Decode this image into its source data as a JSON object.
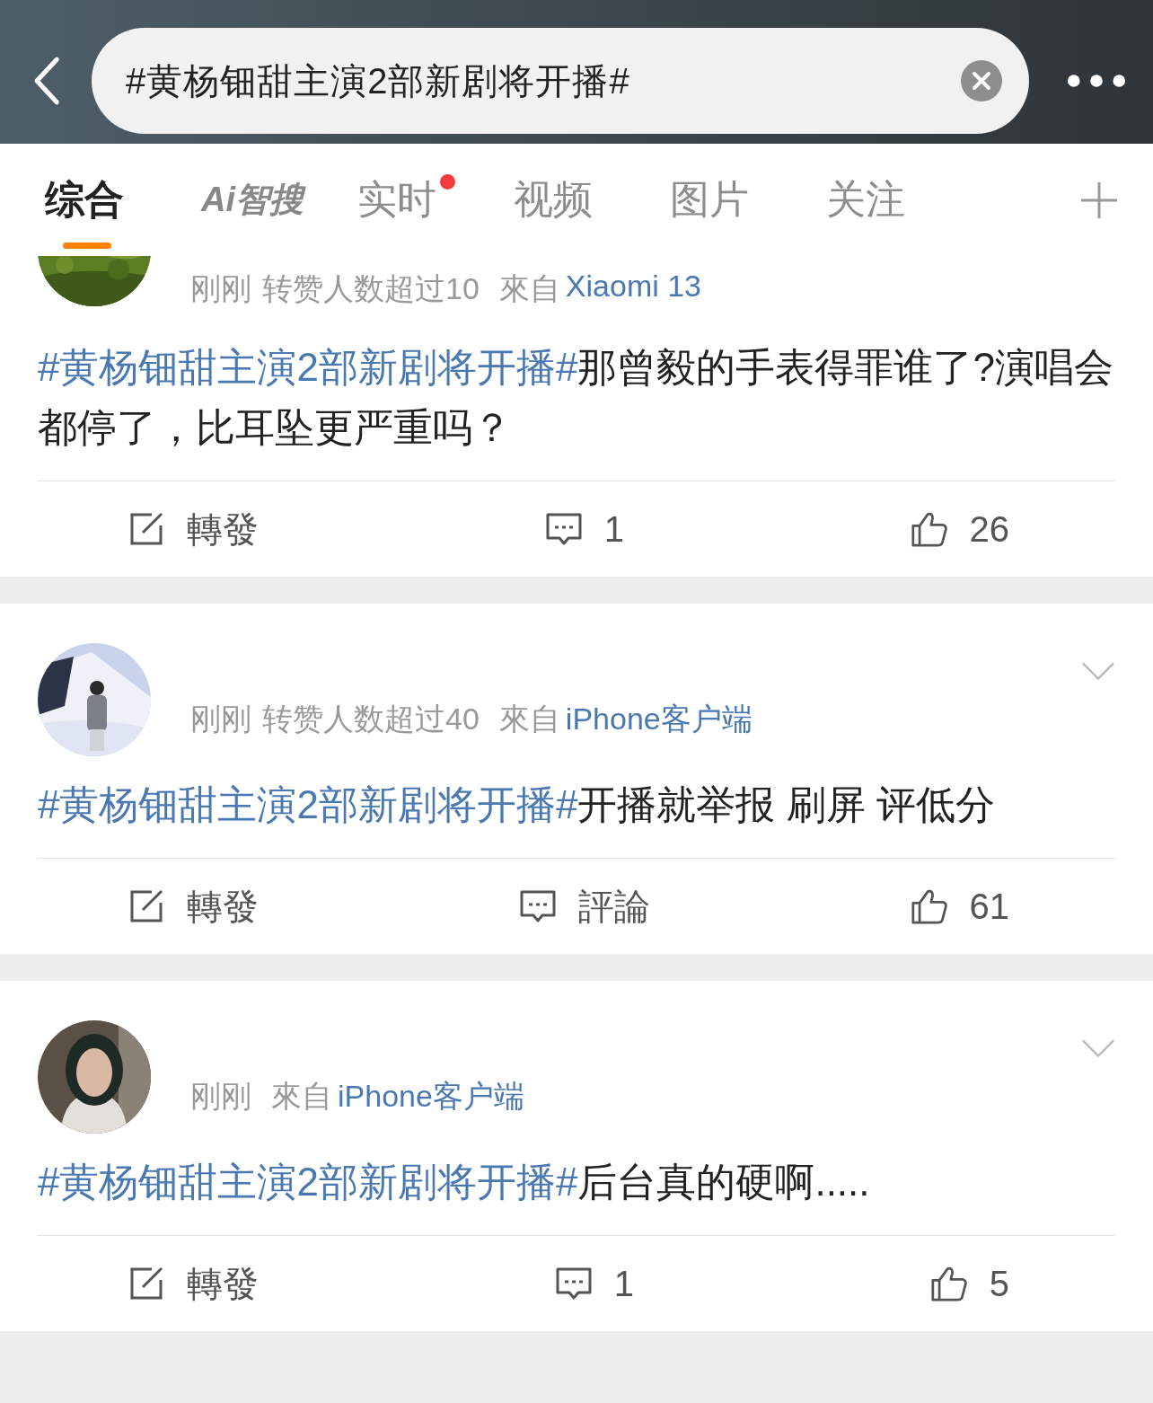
{
  "header": {
    "search_value": "#黄杨钿甜主演2部新剧将开播#"
  },
  "tabs": [
    {
      "kind": "text",
      "label": "综合",
      "selected": true,
      "badge": false
    },
    {
      "kind": "ai",
      "label": "Ai智搜",
      "selected": false,
      "badge": false
    },
    {
      "kind": "text",
      "label": "实时",
      "selected": false,
      "badge": true
    },
    {
      "kind": "text",
      "label": "视频",
      "selected": false,
      "badge": false
    },
    {
      "kind": "text",
      "label": "图片",
      "selected": false,
      "badge": false
    },
    {
      "kind": "text",
      "label": "关注",
      "selected": false,
      "badge": false
    }
  ],
  "posts": [
    {
      "cut_top": true,
      "menu": false,
      "meta": [
        "刚刚",
        "转赞人数超过10"
      ],
      "source_prefix": "來自",
      "source": "Xiaomi 13",
      "hashtag": "#黄杨钿甜主演2部新剧将开播#",
      "text": "那曾毅的手表得罪谁了?演唱会都停了，比耳坠更严重吗？",
      "repost": "轉發",
      "comment": "1",
      "like": "26"
    },
    {
      "cut_top": false,
      "menu": true,
      "meta": [
        "刚刚",
        "转赞人数超过40"
      ],
      "source_prefix": "來自",
      "source": "iPhone客户端",
      "hashtag": "#黄杨钿甜主演2部新剧将开播#",
      "text": "开播就举报 刷屏 评低分",
      "repost": "轉發",
      "comment": "評論",
      "like": "61"
    },
    {
      "cut_top": false,
      "menu": true,
      "meta": [
        "刚刚"
      ],
      "source_prefix": "來自",
      "source": "iPhone客户端",
      "hashtag": "#黄杨钿甜主演2部新剧将开播#",
      "text": "后台真的硬啊.....",
      "repost": "轉發",
      "comment": "1",
      "like": "5"
    }
  ]
}
